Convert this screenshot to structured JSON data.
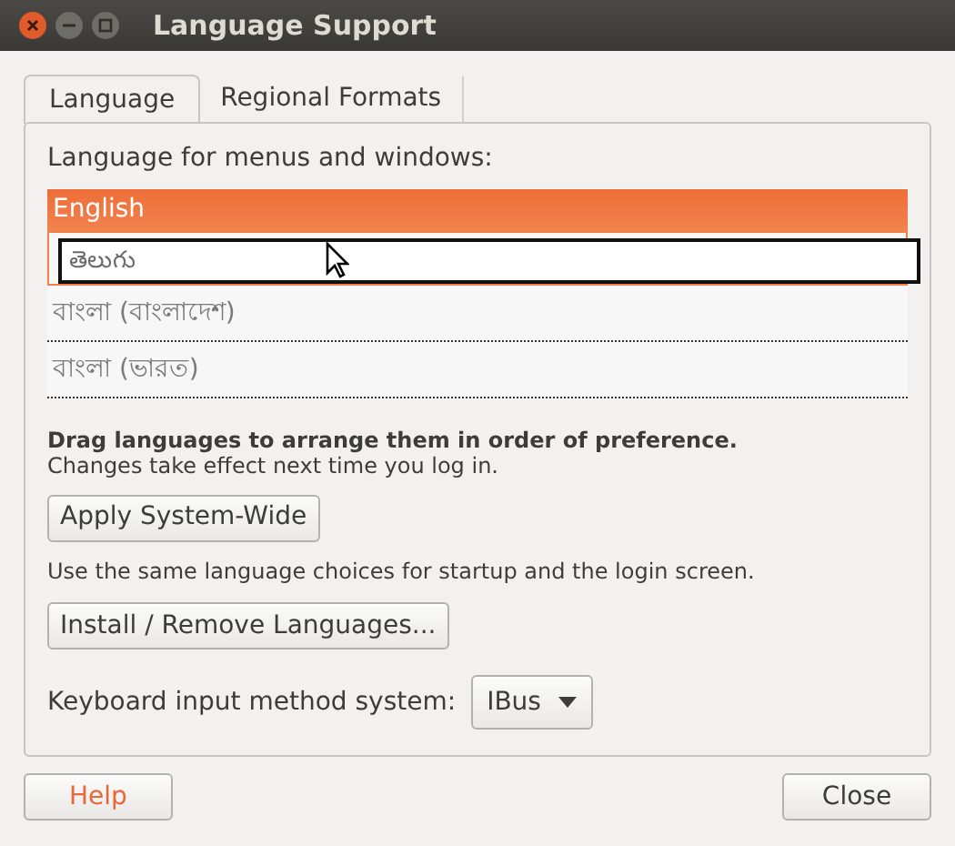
{
  "window": {
    "title": "Language Support"
  },
  "tabs": [
    {
      "label": "Language",
      "selected": true
    },
    {
      "label": "Regional Formats",
      "selected": false
    }
  ],
  "language_list": {
    "label": "Language for menus and windows:",
    "rows": [
      {
        "kind": "language",
        "label": "English",
        "selected": true
      },
      {
        "kind": "drop_target",
        "selected": false
      },
      {
        "kind": "language",
        "label": "বাংলা (বাংলাদেশ)",
        "selected": false
      },
      {
        "kind": "language",
        "label": "বাংলা (ভারত)",
        "selected": false
      }
    ],
    "drag_preview": "తెలుగు"
  },
  "hint": "Drag languages to arrange them in order of preference.",
  "hint_note": "Changes take effect next time you log in.",
  "apply_button": "Apply System-Wide",
  "apply_note": "Use the same language choices for startup and the login screen.",
  "install_button": "Install / Remove Languages...",
  "input_method": {
    "label": "Keyboard input method system:",
    "value": "IBus"
  },
  "buttons": [
    {
      "kind": "help",
      "label": "Help"
    },
    {
      "kind": "close",
      "label": "Close"
    }
  ]
}
